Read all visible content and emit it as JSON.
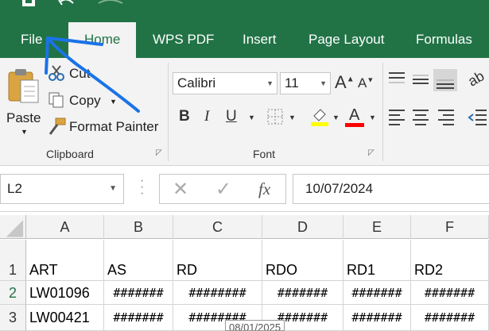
{
  "titlebar": {
    "icons": [
      "save-icon",
      "undo-icon",
      "redo-icon"
    ]
  },
  "tabs": [
    "File",
    "Home",
    "WPS PDF",
    "Insert",
    "Page Layout",
    "Formulas"
  ],
  "active_tab": "Home",
  "clipboard": {
    "paste": "Paste",
    "cut": "Cut",
    "copy": "Copy",
    "format_painter": "Format Painter",
    "label": "Clipboard"
  },
  "font": {
    "family": "Calibri",
    "size": "11",
    "label": "Font",
    "bold": "B",
    "italic": "I",
    "underline": "U",
    "fill_color": "#ffff00",
    "font_color": "#ff0000"
  },
  "formula_bar": {
    "name_box": "L2",
    "value": "10/07/2024"
  },
  "sheet": {
    "columns": [
      "A",
      "B",
      "C",
      "D",
      "E",
      "F"
    ],
    "rows": [
      {
        "num": "1",
        "cells": [
          "ART",
          "AS",
          "RD",
          "RDO",
          "RD1",
          "RD2"
        ]
      },
      {
        "num": "2",
        "cells": [
          "LW01096",
          "#######",
          "########",
          "#######",
          "#######",
          "#######"
        ]
      },
      {
        "num": "3",
        "cells": [
          "LW00421",
          "#######",
          "########",
          "#######",
          "#######",
          "#######"
        ]
      }
    ],
    "tooltip": "08/01/2025"
  },
  "colors": {
    "accent": "#217346",
    "annotation": "#1a73e8"
  }
}
